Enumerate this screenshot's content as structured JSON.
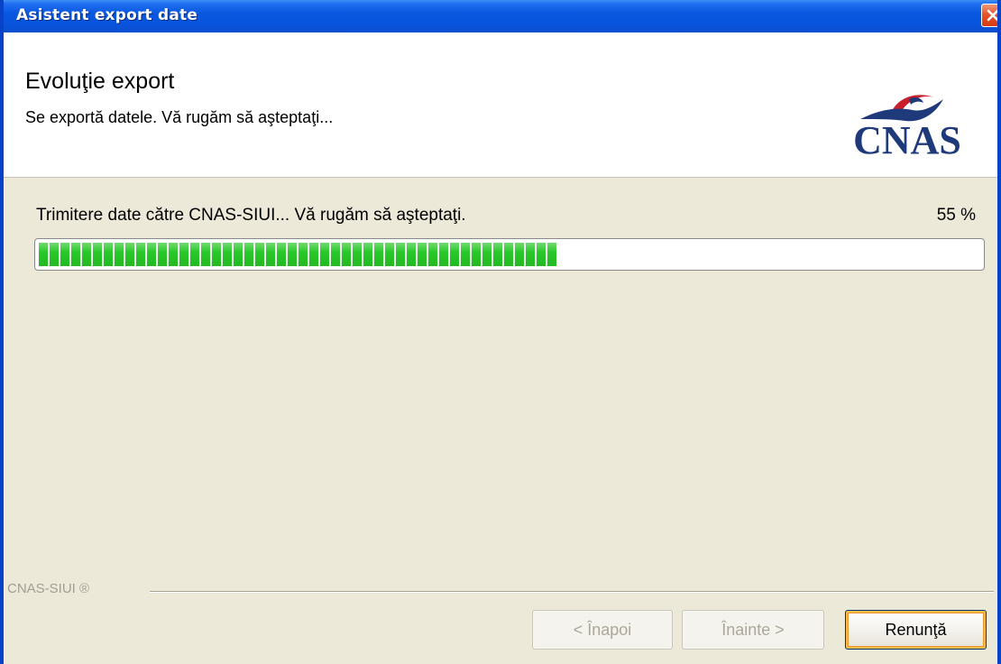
{
  "window": {
    "title": "Asistent export date"
  },
  "header": {
    "heading": "Evoluţie export",
    "subtitle": "Se exportă datele. Vă rugăm să aşteptaţi...",
    "logo_text": "CNAS"
  },
  "progress": {
    "status": "Trimitere date către CNAS-SIUI... Vă rugăm să aşteptaţi.",
    "percent_label": "55 %",
    "value_percent": 55
  },
  "footer": {
    "brand": "CNAS-SIUI ®"
  },
  "buttons": {
    "back_label": "< Înapoi",
    "next_label": "Înainte >",
    "cancel_label": "Renunţă"
  },
  "colors": {
    "titlebar": "#0a58e0",
    "progress_fill": "#28c828",
    "logo_blue": "#1f3a7a",
    "logo_red": "#c8202a",
    "close_button": "#e5552a"
  },
  "icons": {
    "close": "close-icon",
    "logo": "cnas-logo"
  }
}
